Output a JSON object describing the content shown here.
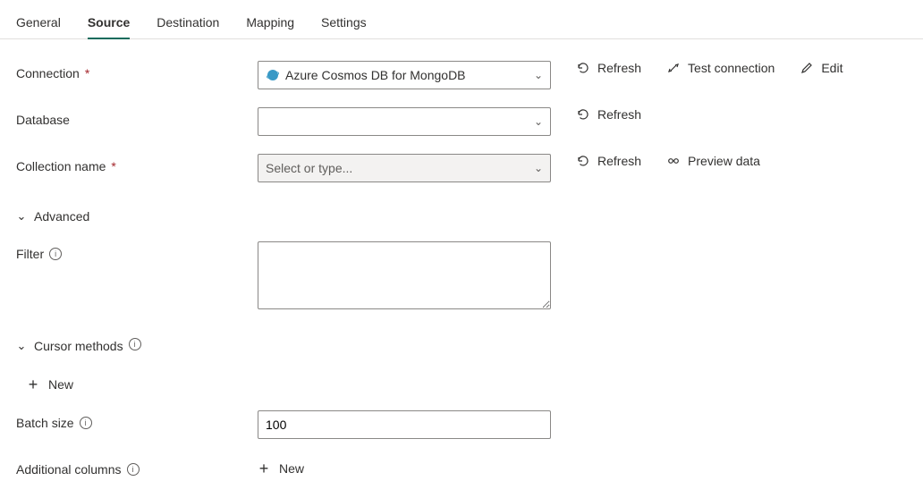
{
  "tabs": {
    "general": "General",
    "source": "Source",
    "destination": "Destination",
    "mapping": "Mapping",
    "settings": "Settings",
    "active": "source"
  },
  "labels": {
    "connection": "Connection",
    "database": "Database",
    "collection": "Collection name",
    "advanced": "Advanced",
    "filter": "Filter",
    "cursor": "Cursor methods",
    "batch": "Batch size",
    "additional": "Additional columns"
  },
  "fields": {
    "connection_value": "Azure Cosmos DB for MongoDB",
    "database_value": "",
    "collection_placeholder": "Select or type...",
    "filter_value": "",
    "batch_value": "100"
  },
  "actions": {
    "refresh": "Refresh",
    "test": "Test connection",
    "edit": "Edit",
    "preview": "Preview data",
    "new": "New"
  }
}
